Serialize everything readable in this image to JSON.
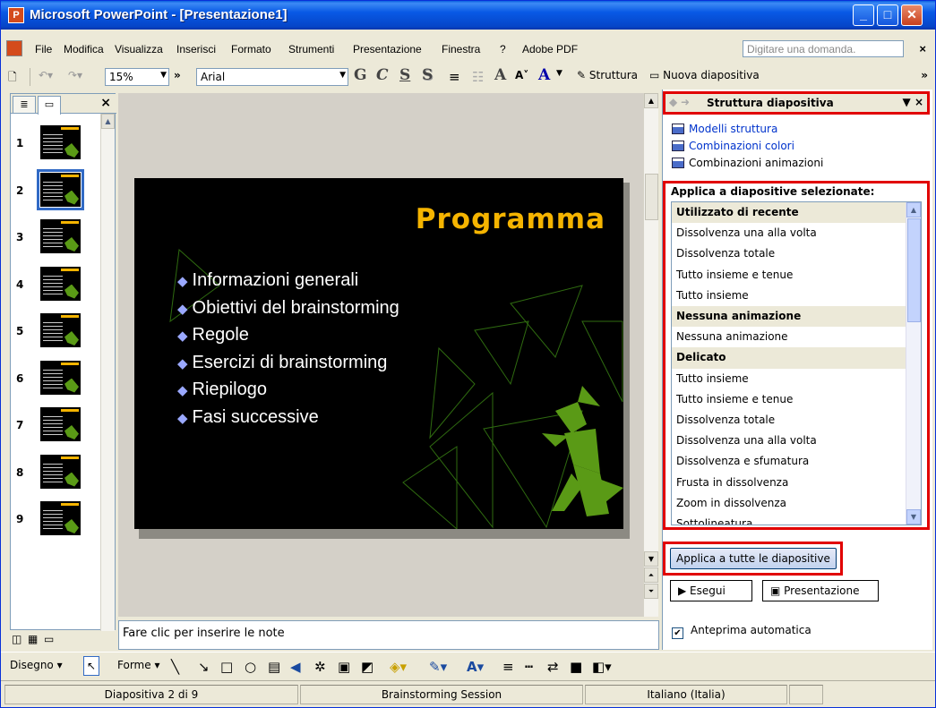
{
  "window": {
    "title": "Microsoft PowerPoint - [Presentazione1]",
    "controls": {
      "minimize": "_",
      "maximize": "□",
      "close": "✕"
    }
  },
  "menubar": {
    "items": [
      {
        "label": "File"
      },
      {
        "label": "Modifica"
      },
      {
        "label": "Visualizza"
      },
      {
        "label": "Inserisci"
      },
      {
        "label": "Formato"
      },
      {
        "label": "Strumenti"
      },
      {
        "label": "Presentazione"
      },
      {
        "label": "Finestra"
      },
      {
        "label": "?"
      },
      {
        "label": "Adobe PDF"
      }
    ],
    "help_placeholder": "Digitare una domanda.",
    "close": "×"
  },
  "toolbar": {
    "zoom": "15%",
    "font": "Arial",
    "bold_glyph": "G",
    "italic_glyph": "C",
    "underline_glyph": "S",
    "shadow_glyph": "S",
    "design_label": "Struttura",
    "new_slide_label": "Nuova diapositiva"
  },
  "left_panel": {
    "thumbnails": [
      {
        "num": "1"
      },
      {
        "num": "2"
      },
      {
        "num": "3"
      },
      {
        "num": "4"
      },
      {
        "num": "5"
      },
      {
        "num": "6"
      },
      {
        "num": "7"
      },
      {
        "num": "8"
      },
      {
        "num": "9"
      }
    ],
    "selected": "2"
  },
  "slide": {
    "title": "Programma",
    "bullets": [
      "Informazioni generali",
      "Obiettivi del brainstorming",
      "Regole",
      "Esercizi di brainstorming",
      "Riepilogo",
      "Fasi successive"
    ],
    "title_color": "#f5b400",
    "accent_color": "#5a9a16"
  },
  "notes": {
    "placeholder": "Fare clic per inserire le note"
  },
  "task_pane": {
    "title": "Struttura diapositiva",
    "links": [
      "Modelli struttura",
      "Combinazioni colori",
      "Combinazioni animazioni"
    ],
    "apply_header": "Applica a diapositive selezionate:",
    "list": [
      {
        "label": "Utilizzato di recente",
        "group": true
      },
      {
        "label": "Dissolvenza una alla volta",
        "group": false
      },
      {
        "label": "Dissolvenza totale",
        "group": false
      },
      {
        "label": "Tutto insieme e tenue",
        "group": false
      },
      {
        "label": "Tutto insieme",
        "group": false
      },
      {
        "label": "Nessuna animazione",
        "group": true
      },
      {
        "label": "Nessuna animazione",
        "group": false
      },
      {
        "label": "Delicato",
        "group": true
      },
      {
        "label": "Tutto insieme",
        "group": false
      },
      {
        "label": "Tutto insieme e tenue",
        "group": false
      },
      {
        "label": "Dissolvenza totale",
        "group": false
      },
      {
        "label": "Dissolvenza una alla volta",
        "group": false
      },
      {
        "label": "Dissolvenza e sfumatura",
        "group": false
      },
      {
        "label": "Frusta in dissolvenza",
        "group": false
      },
      {
        "label": "Zoom in dissolvenza",
        "group": false
      },
      {
        "label": "Sottolineatura",
        "group": false
      }
    ],
    "apply_all_label": "Applica a tutte le diapositive",
    "play_label": "Esegui",
    "slideshow_label": "Presentazione",
    "autopreview_label": "Anteprima automatica",
    "autopreview_checked": true,
    "highlight_color": "#e10000"
  },
  "drawing_toolbar": {
    "draw_label": "Disegno",
    "shapes_label": "Forme"
  },
  "status_bar": {
    "slide_info": "Diapositiva 2 di 9",
    "design_name": "Brainstorming Session",
    "language": "Italiano (Italia)"
  }
}
